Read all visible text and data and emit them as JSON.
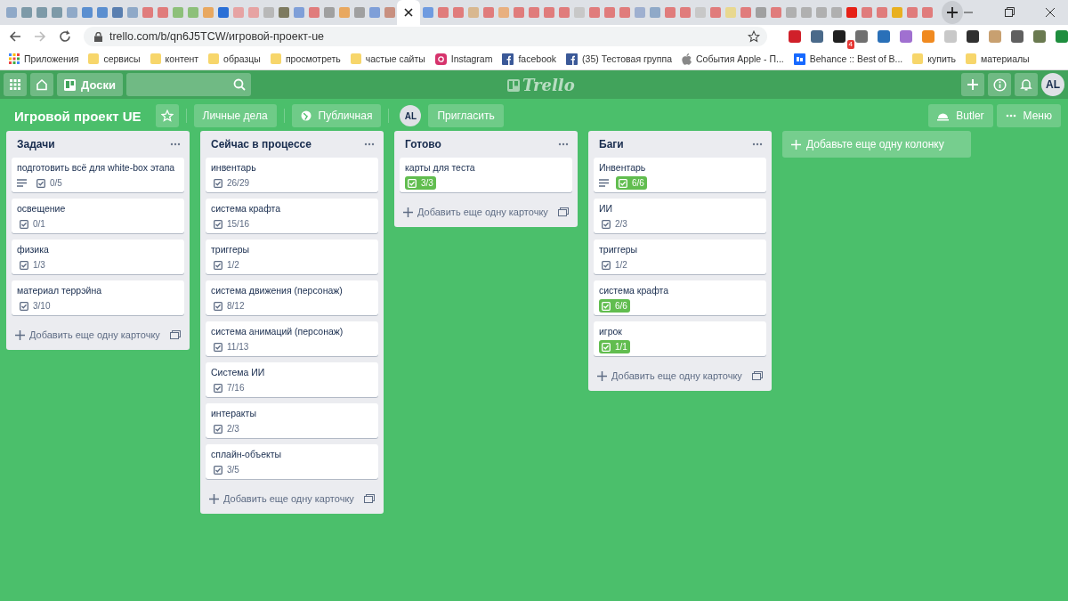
{
  "browser": {
    "tabs": [
      {
        "color": "#8fa9c8",
        "selected": false
      },
      {
        "color": "#7d9aa8",
        "selected": false
      },
      {
        "color": "#7d9aa8",
        "selected": false
      },
      {
        "color": "#7d9aa8",
        "selected": false
      },
      {
        "color": "#8fa9c8",
        "selected": false
      },
      {
        "color": "#5b8fd0",
        "selected": false
      },
      {
        "color": "#5b8fd0",
        "selected": false
      },
      {
        "color": "#5a7fb0",
        "selected": false
      },
      {
        "color": "#8fa9c8",
        "selected": false
      },
      {
        "color": "#e07c7c",
        "selected": false
      },
      {
        "color": "#e07c7c",
        "selected": false
      },
      {
        "color": "#8dc07a",
        "selected": false
      },
      {
        "color": "#8dc07a",
        "selected": false
      },
      {
        "color": "#e8a860",
        "selected": false
      },
      {
        "color": "#2a6fd6",
        "selected": false
      },
      {
        "color": "#e6a3a3",
        "selected": false
      },
      {
        "color": "#e6a3a3",
        "selected": false
      },
      {
        "color": "#b8b8b8",
        "selected": false
      },
      {
        "color": "#7d7a60",
        "selected": false
      },
      {
        "color": "#7f9fd8",
        "selected": false
      },
      {
        "color": "#e07c7c",
        "selected": false
      },
      {
        "color": "#a0a0a0",
        "selected": false
      },
      {
        "color": "#e8a860",
        "selected": false
      },
      {
        "color": "#a0a0a0",
        "selected": false
      },
      {
        "color": "#7f9fd8",
        "selected": false
      },
      {
        "color": "#c89080",
        "selected": false
      },
      {
        "selected": true
      },
      {
        "color": "#6f9be0",
        "selected": false
      },
      {
        "color": "#e07c7c",
        "selected": false
      },
      {
        "color": "#e07c7c",
        "selected": false
      },
      {
        "color": "#d8b890",
        "selected": false
      },
      {
        "color": "#e07c7c",
        "selected": false
      },
      {
        "color": "#e8b080",
        "selected": false
      },
      {
        "color": "#e07c7c",
        "selected": false
      },
      {
        "color": "#e07c7c",
        "selected": false
      },
      {
        "color": "#e07c7c",
        "selected": false
      },
      {
        "color": "#e07c7c",
        "selected": false
      },
      {
        "color": "#c8c8c8",
        "selected": false
      },
      {
        "color": "#e07c7c",
        "selected": false
      },
      {
        "color": "#e07c7c",
        "selected": false
      },
      {
        "color": "#e07c7c",
        "selected": false
      },
      {
        "color": "#9fb0d0",
        "selected": false
      },
      {
        "color": "#8fa9c8",
        "selected": false
      },
      {
        "color": "#e07c7c",
        "selected": false
      },
      {
        "color": "#e07c7c",
        "selected": false
      },
      {
        "color": "#c8c8c8",
        "selected": false
      },
      {
        "color": "#e07c7c",
        "selected": false
      },
      {
        "color": "#e8d890",
        "selected": false
      },
      {
        "color": "#e07c7c",
        "selected": false
      },
      {
        "color": "#a0a0a0",
        "selected": false
      },
      {
        "color": "#e07c7c",
        "selected": false
      },
      {
        "color": "#b0b0b0",
        "selected": false
      },
      {
        "color": "#b0b0b0",
        "selected": false
      },
      {
        "color": "#b0b0b0",
        "selected": false
      },
      {
        "color": "#b0b0b0",
        "selected": false
      },
      {
        "color": "#e62117",
        "selected": false
      },
      {
        "color": "#e07c7c",
        "selected": false
      },
      {
        "color": "#e07c7c",
        "selected": false
      },
      {
        "color": "#e8b020",
        "selected": false
      },
      {
        "color": "#e07c7c",
        "selected": false
      },
      {
        "color": "#e07c7c",
        "selected": false
      }
    ],
    "address": "trello.com/b/qn6J5TCW/игровой-проект-ue",
    "extensions": [
      {
        "color": "#d0202a"
      },
      {
        "color": "#4a6a8a"
      },
      {
        "color": "#202020",
        "badge": "4"
      },
      {
        "color": "#707070"
      },
      {
        "color": "#2a70b8"
      },
      {
        "color": "#a070d0"
      },
      {
        "color": "#f08a20"
      },
      {
        "color": "#c8c8c8"
      },
      {
        "color": "#303030"
      },
      {
        "color": "#c8a070"
      },
      {
        "color": "#606060"
      },
      {
        "color": "#6a7a50"
      },
      {
        "color": "#1e8e3e"
      }
    ],
    "bookmarks": [
      {
        "kind": "apps",
        "label": "Приложения"
      },
      {
        "kind": "folder",
        "label": "сервисы"
      },
      {
        "kind": "folder",
        "label": "контент"
      },
      {
        "kind": "folder",
        "label": "образцы"
      },
      {
        "kind": "folder",
        "label": "просмотреть"
      },
      {
        "kind": "folder",
        "label": "частые сайты"
      },
      {
        "kind": "instagram",
        "label": "Instagram"
      },
      {
        "kind": "facebook",
        "label": "facebook"
      },
      {
        "kind": "facebook",
        "label": "(35) Тестовая группа"
      },
      {
        "kind": "apple",
        "label": "События Apple - П..."
      },
      {
        "kind": "behance",
        "label": "Behance :: Best of B..."
      },
      {
        "kind": "folder",
        "label": "купить"
      },
      {
        "kind": "folder",
        "label": "материалы"
      }
    ]
  },
  "header": {
    "boards_button": "Доски",
    "logo": "Trello",
    "avatar": "AL"
  },
  "board": {
    "title": "Игровой проект UE",
    "team_button": "Личные дела",
    "visibility_button": "Публичная",
    "member": "AL",
    "invite_button": "Пригласить",
    "butler_button": "Butler",
    "menu_button": "Меню",
    "add_list": "Добавьте еще одну колонку",
    "lists": [
      {
        "title": "Задачи",
        "add_card": "Добавить еще одну карточку",
        "cards": [
          {
            "title": "подготовить всё для white-box этапа",
            "description": true,
            "checklist": "0/5",
            "complete": false
          },
          {
            "title": "освещение",
            "description": false,
            "checklist": "0/1",
            "complete": false
          },
          {
            "title": "физика",
            "description": false,
            "checklist": "1/3",
            "complete": false
          },
          {
            "title": "материал террэйна",
            "description": false,
            "checklist": "3/10",
            "complete": false
          }
        ]
      },
      {
        "title": "Сейчас в процессе",
        "add_card": "Добавить еще одну карточку",
        "cards": [
          {
            "title": "инвентарь",
            "description": false,
            "checklist": "26/29",
            "complete": false
          },
          {
            "title": "система крафта",
            "description": false,
            "checklist": "15/16",
            "complete": false
          },
          {
            "title": "триггеры",
            "description": false,
            "checklist": "1/2",
            "complete": false
          },
          {
            "title": "система движения (персонаж)",
            "description": false,
            "checklist": "8/12",
            "complete": false
          },
          {
            "title": "система анимаций (персонаж)",
            "description": false,
            "checklist": "11/13",
            "complete": false
          },
          {
            "title": "Система ИИ",
            "description": false,
            "checklist": "7/16",
            "complete": false
          },
          {
            "title": "интеракты",
            "description": false,
            "checklist": "2/3",
            "complete": false
          },
          {
            "title": "сплайн-объекты",
            "description": false,
            "checklist": "3/5",
            "complete": false
          }
        ]
      },
      {
        "title": "Готово",
        "add_card": "Добавить еще одну карточку",
        "cards": [
          {
            "title": "карты для теста",
            "description": false,
            "checklist": "3/3",
            "complete": true
          }
        ]
      },
      {
        "title": "Баги",
        "add_card": "Добавить еще одну карточку",
        "cards": [
          {
            "title": "Инвентарь",
            "description": true,
            "checklist": "6/6",
            "complete": true
          },
          {
            "title": "ИИ",
            "description": false,
            "checklist": "2/3",
            "complete": false
          },
          {
            "title": "триггеры",
            "description": false,
            "checklist": "1/2",
            "complete": false
          },
          {
            "title": "система крафта",
            "description": false,
            "checklist": "6/6",
            "complete": true
          },
          {
            "title": "игрок",
            "description": false,
            "checklist": "1/1",
            "complete": true
          }
        ]
      }
    ]
  }
}
